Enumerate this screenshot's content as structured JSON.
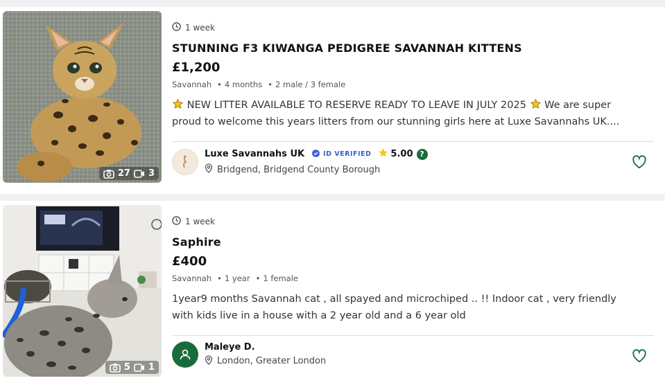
{
  "listings": [
    {
      "age": "1 week",
      "title": "STUNNING F3 KIWANGA PEDIGREE SAVANNAH KITTENS",
      "price": "£1,200",
      "breed": "Savannah",
      "age_detail": "4 months",
      "gender_detail": "2 male / 3 female",
      "desc_line1": "NEW LITTER AVAILABLE TO RESERVE READY TO LEAVE IN JULY 2025",
      "desc_line1_tail": "We are super",
      "desc_line2": "proud to welcome this years litters from our stunning girls here at Luxe Savannahs UK....",
      "photo_count": "27",
      "video_count": "3",
      "seller_name": "Luxe Savannahs UK",
      "verified_label": "ID VERIFIED",
      "rating": "5.00",
      "help_label": "?",
      "location": "Bridgend, Bridgend County Borough",
      "icons": {
        "clock": "clock-icon",
        "camera": "camera-icon",
        "video": "video-icon",
        "pin": "location-pin-icon",
        "heart": "heart-outline-icon",
        "star": "star-icon",
        "badge": "verified-badge-icon"
      }
    },
    {
      "age": "1 week",
      "title": "Saphire",
      "price": "£400",
      "breed": "Savannah",
      "age_detail": "1 year",
      "gender_detail": "1 female",
      "desc_line1": "1year9 months Savannah cat , all spayed and microchiped .. !! Indoor cat , very friendly",
      "desc_line2": "with kids live in a house with a 2 year old and a 6 year old",
      "photo_count": "5",
      "video_count": "1",
      "seller_name": "Maleye D.",
      "location": "London, Greater London",
      "icons": {
        "clock": "clock-icon",
        "camera": "camera-icon",
        "video": "video-icon",
        "pin": "location-pin-icon",
        "heart": "heart-outline-icon",
        "avatar": "user-icon"
      }
    }
  ],
  "colors": {
    "accent_green": "#1a6b3c",
    "heart_green": "#1a6b3c",
    "verified_blue": "#3a5fcf",
    "star_yellow": "#f5c518"
  }
}
